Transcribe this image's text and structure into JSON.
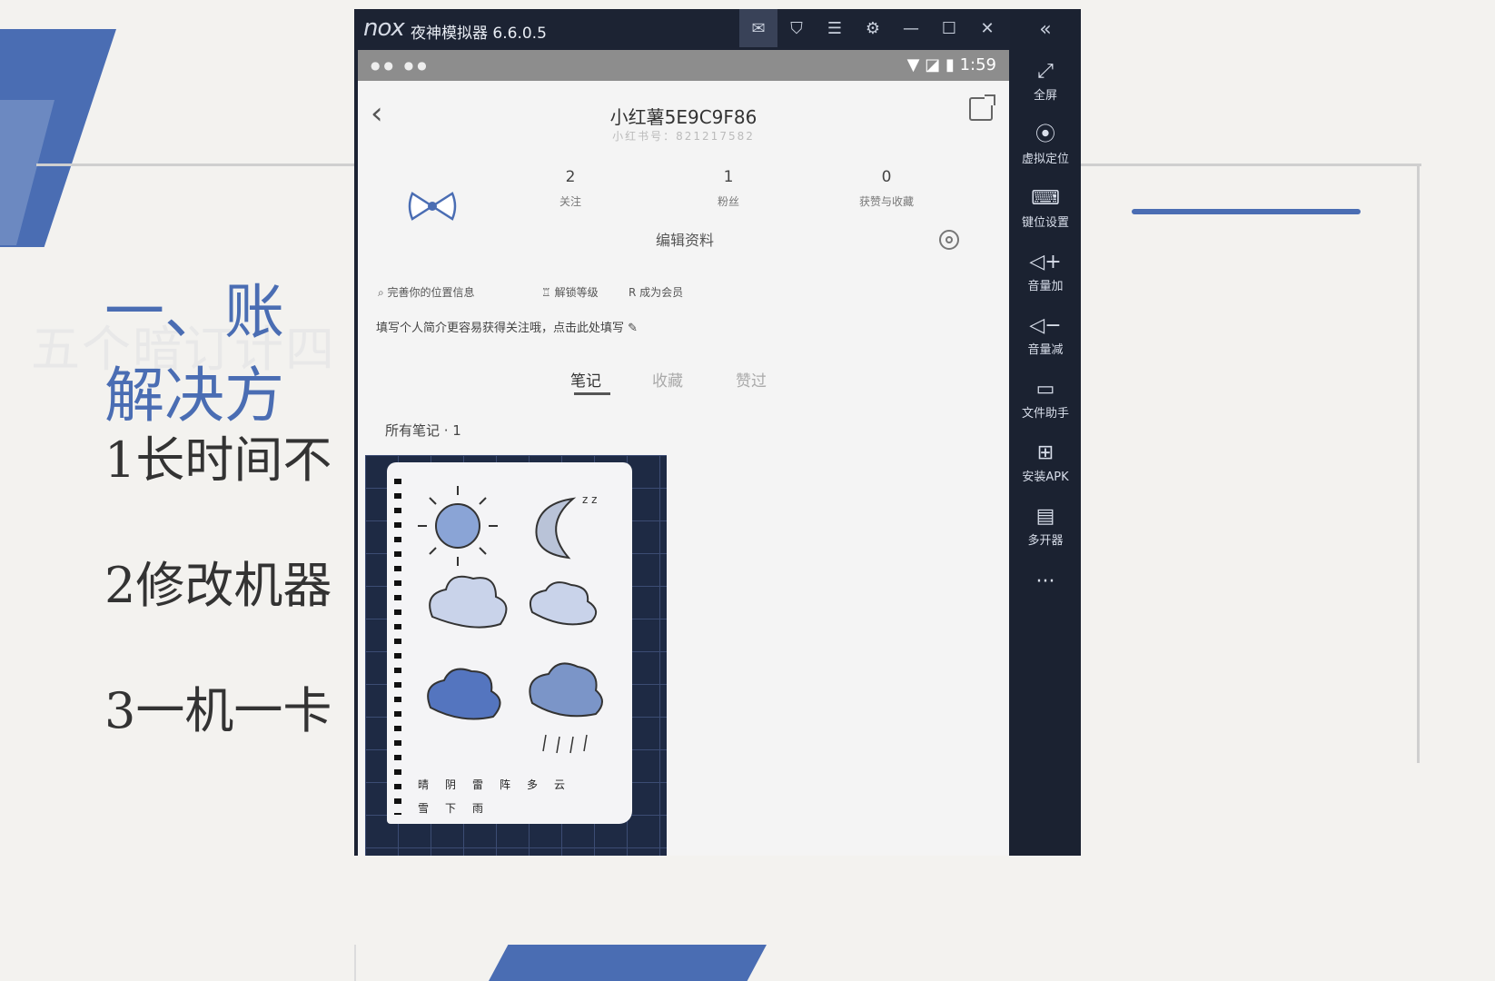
{
  "slide": {
    "heading_line1": "一、账",
    "heading_line2": "解决方",
    "ghost_text": "五个暗订计四",
    "items": [
      "1长时间不",
      "2修改机器",
      "3一机一卡"
    ]
  },
  "emulator": {
    "logo": "nox",
    "title": "夜神模拟器 6.6.0.5",
    "titlebar_icons": [
      "mail-icon",
      "shirt-icon",
      "menu-icon",
      "settings-icon",
      "minimize-icon",
      "maximize-icon",
      "close-icon"
    ],
    "collapse_glyph": "«",
    "sidebar": [
      {
        "icon": "fullscreen-icon",
        "label": "全屏"
      },
      {
        "icon": "location-icon",
        "label": "虚拟定位"
      },
      {
        "icon": "keyboard-icon",
        "label": "键位设置"
      },
      {
        "icon": "volume-up-icon",
        "label": "音量加"
      },
      {
        "icon": "volume-down-icon",
        "label": "音量减"
      },
      {
        "icon": "file-assistant-icon",
        "label": "文件助手"
      },
      {
        "icon": "install-apk-icon",
        "label": "安装APK"
      },
      {
        "icon": "multi-instance-icon",
        "label": "多开器"
      },
      {
        "icon": "more-icon",
        "label": "···"
      }
    ]
  },
  "phone": {
    "status_time": "1:59",
    "username": "小红薯5E9C9F86",
    "userid": "小红书号：821217582",
    "stats": [
      {
        "num": "2",
        "label": "关注"
      },
      {
        "num": "1",
        "label": "粉丝"
      },
      {
        "num": "0",
        "label": "获赞与收藏"
      }
    ],
    "edit_profile": "编辑资料",
    "chips": [
      "完善你的位置信息",
      "解锁等级",
      "成为会员"
    ],
    "bio": "填写个人简介更容易获得关注哦，点击此处填写",
    "tabs": [
      "笔记",
      "收藏",
      "赞过"
    ],
    "active_tab": "笔记",
    "notes_count": "所有笔记 · 1",
    "note_caption": [
      "晴",
      "阴",
      "雷阵",
      "多云"
    ],
    "note_caption2": [
      "雪",
      "下雨"
    ]
  }
}
